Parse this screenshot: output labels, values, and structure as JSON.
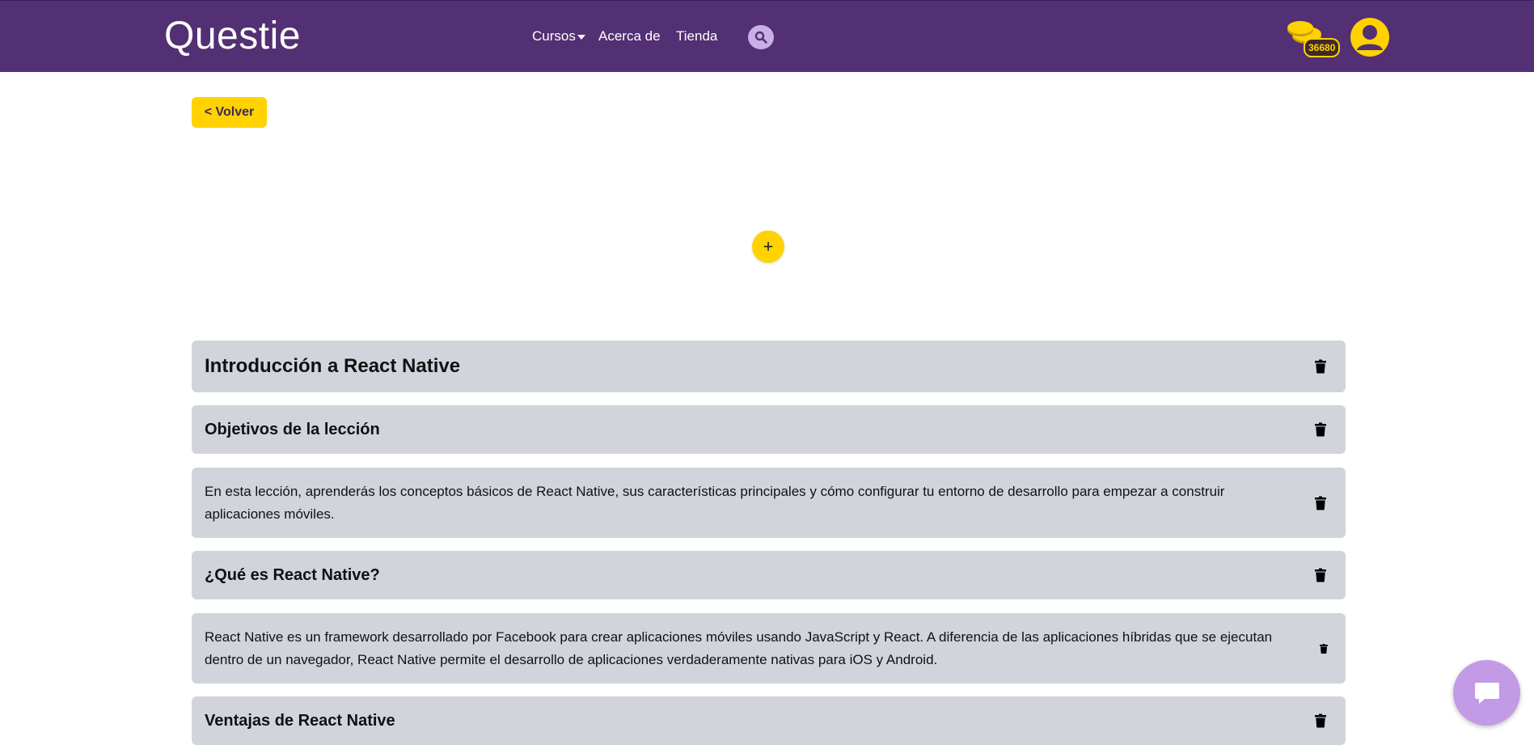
{
  "header": {
    "logo": "Questie",
    "nav": {
      "cursos": "Cursos",
      "acerca": "Acerca de",
      "tienda": "Tienda"
    },
    "coins": "36680",
    "icons": {
      "search": "search-icon",
      "coins": "coins-icon",
      "avatar": "user-icon"
    }
  },
  "back_label": "< Volver",
  "add_label": "+",
  "blocks": [
    {
      "type": "heading-1",
      "text": "Introducción a React Native"
    },
    {
      "type": "heading-2",
      "text": "Objetivos de la lección"
    },
    {
      "type": "paragraph",
      "text": "En esta lección, aprenderás los conceptos básicos de React Native, sus características principales y cómo configurar tu entorno de desarrollo para empezar a construir aplicaciones móviles."
    },
    {
      "type": "heading-2",
      "text": "¿Qué es React Native?"
    },
    {
      "type": "paragraph",
      "text": "React Native es un framework desarrollado por Facebook para crear aplicaciones móviles usando JavaScript y React. A diferencia de las aplicaciones híbridas que se ejecutan dentro de un navegador, React Native permite el desarrollo de aplicaciones verdaderamente nativas para iOS y Android."
    },
    {
      "type": "heading-2",
      "text": "Ventajas de React Native"
    }
  ],
  "colors": {
    "header_bg": "#532f73",
    "accent": "#ffd200",
    "block_bg": "#d2d4dc",
    "chat_bg": "#c39ae6"
  }
}
